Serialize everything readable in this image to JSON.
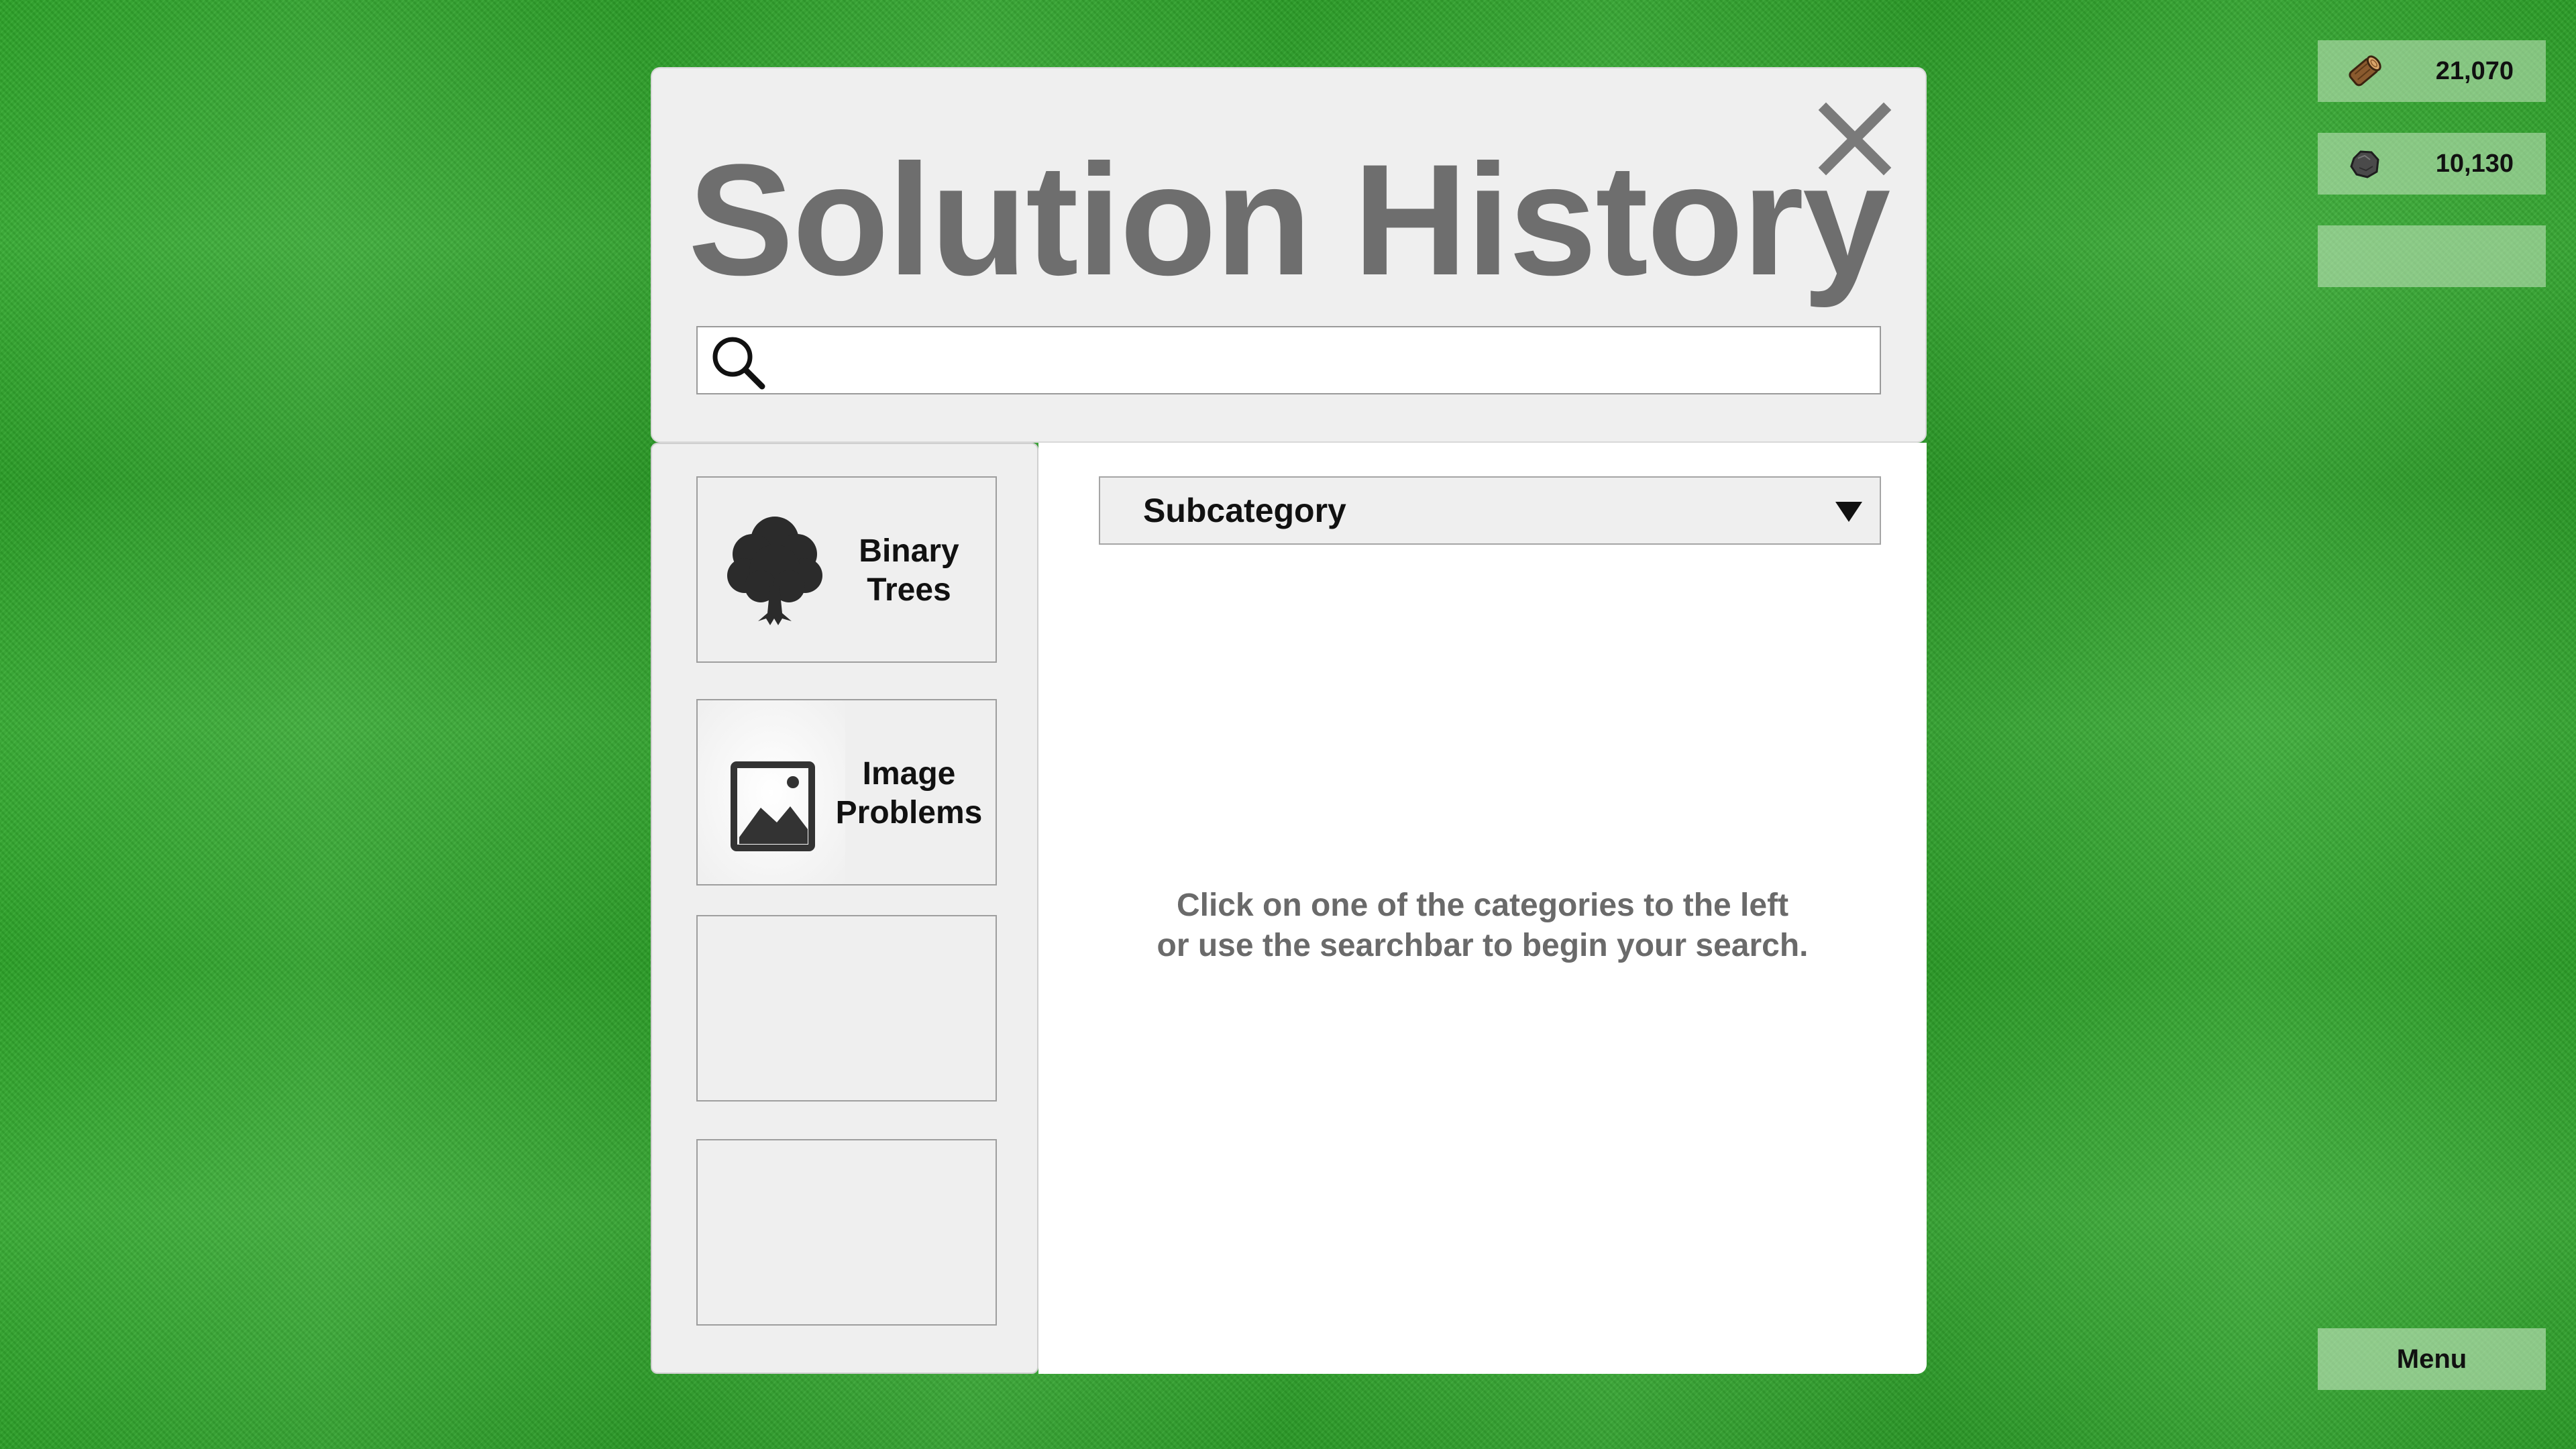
{
  "resources": [
    {
      "name": "wood",
      "icon": "wood-log-icon",
      "value": "21,070"
    },
    {
      "name": "stone",
      "icon": "stone-icon",
      "value": "10,130"
    },
    {
      "name": "empty",
      "icon": "",
      "value": ""
    }
  ],
  "menu": {
    "label": "Menu"
  },
  "dialog": {
    "title": "Solution History",
    "close_icon": "close-icon",
    "search": {
      "placeholder": "",
      "value": "",
      "icon": "search-icon"
    },
    "categories": [
      {
        "label_line1": "Binary",
        "label_line2": "Trees",
        "icon": "tree-icon"
      },
      {
        "label_line1": "Image",
        "label_line2": "Problems",
        "icon": "image-icon"
      },
      {
        "label_line1": "",
        "label_line2": "",
        "icon": ""
      },
      {
        "label_line1": "",
        "label_line2": "",
        "icon": ""
      }
    ],
    "subcategory": {
      "label": "Subcategory",
      "icon": "chevron-down-icon"
    },
    "hint": {
      "line1": "Click on one of the categories to the left",
      "line2": "or use the searchbar to begin your search."
    }
  },
  "colors": {
    "background_grass": "#2ea82a",
    "panel": "#efefef",
    "title_text": "#6e6e6e",
    "hint_text": "#6a6a6a",
    "hud_box": "#c8e6c3"
  }
}
